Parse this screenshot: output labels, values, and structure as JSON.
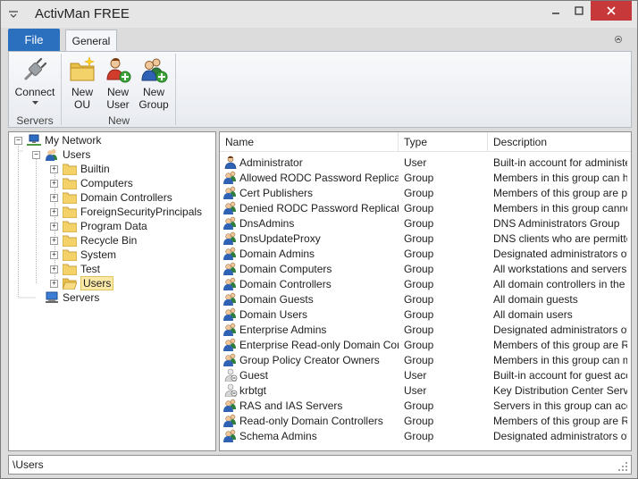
{
  "window": {
    "title": "ActivMan FREE"
  },
  "ribbon": {
    "file_tab": "File",
    "general_tab": "General",
    "buttons": {
      "connect": [
        "Connect"
      ],
      "new_ou": [
        "New",
        "OU"
      ],
      "new_user": [
        "New",
        "User"
      ],
      "new_group": [
        "New",
        "Group"
      ]
    },
    "groups": {
      "servers": "Servers",
      "new": "New"
    }
  },
  "tree": {
    "root": "My Network",
    "users": "Users",
    "children": [
      "Builtin",
      "Computers",
      "Domain Controllers",
      "ForeignSecurityPrincipals",
      "Program Data",
      "Recycle Bin",
      "System",
      "Test",
      "Users"
    ],
    "servers": "Servers"
  },
  "list": {
    "columns": [
      "Name",
      "Type",
      "Description"
    ],
    "rows": [
      {
        "name": "Administrator",
        "type": "User",
        "desc": "Built-in account for administer..."
      },
      {
        "name": "Allowed RODC Password Replicati...",
        "type": "Group",
        "desc": "Members in this group can h..."
      },
      {
        "name": "Cert Publishers",
        "type": "Group",
        "desc": "Members of this group are pe..."
      },
      {
        "name": "Denied RODC Password Replicatio...",
        "type": "Group",
        "desc": "Members in this group canno..."
      },
      {
        "name": "DnsAdmins",
        "type": "Group",
        "desc": "DNS Administrators Group"
      },
      {
        "name": "DnsUpdateProxy",
        "type": "Group",
        "desc": "DNS clients who are permitte..."
      },
      {
        "name": "Domain Admins",
        "type": "Group",
        "desc": "Designated administrators of ..."
      },
      {
        "name": "Domain Computers",
        "type": "Group",
        "desc": "All workstations and servers j..."
      },
      {
        "name": "Domain Controllers",
        "type": "Group",
        "desc": "All domain controllers in the d..."
      },
      {
        "name": "Domain Guests",
        "type": "Group",
        "desc": "All domain guests"
      },
      {
        "name": "Domain Users",
        "type": "Group",
        "desc": "All domain users"
      },
      {
        "name": "Enterprise Admins",
        "type": "Group",
        "desc": "Designated administrators of ..."
      },
      {
        "name": "Enterprise Read-only Domain Contr...",
        "type": "Group",
        "desc": "Members of this group are R..."
      },
      {
        "name": "Group Policy Creator Owners",
        "type": "Group",
        "desc": "Members in this group can m..."
      },
      {
        "name": "Guest",
        "type": "User",
        "desc": "Built-in account for guest acc..."
      },
      {
        "name": "krbtgt",
        "type": "User",
        "desc": "Key Distribution Center Servi..."
      },
      {
        "name": "RAS and IAS Servers",
        "type": "Group",
        "desc": "Servers in this group can acc..."
      },
      {
        "name": "Read-only Domain Controllers",
        "type": "Group",
        "desc": "Members of this group are R..."
      },
      {
        "name": "Schema Admins",
        "type": "Group",
        "desc": "Designated administrators of ..."
      }
    ]
  },
  "status": {
    "path": "\\Users"
  },
  "colors": {
    "file_tab": "#2b6fbf",
    "close_button": "#c7383a",
    "selection": "#fbe9a8"
  }
}
